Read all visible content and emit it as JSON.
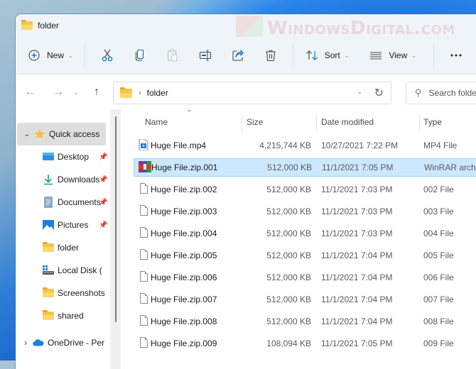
{
  "window": {
    "title": "folder",
    "watermark": "WindowsDigital.com"
  },
  "toolbar": {
    "new_label": "New",
    "sort_label": "Sort",
    "view_label": "View",
    "icons": [
      "cut-icon",
      "copy-icon",
      "paste-icon",
      "rename-icon",
      "share-icon",
      "delete-icon",
      "more-icon"
    ]
  },
  "navigation": {
    "address_path": [
      "folder"
    ],
    "search_placeholder": "Search folder"
  },
  "sidebar": {
    "items": [
      {
        "label": "Quick access",
        "icon": "star-icon",
        "expanded": true,
        "selected": true
      },
      {
        "label": "Desktop",
        "icon": "desktop-icon",
        "pinned": true
      },
      {
        "label": "Downloads",
        "icon": "download-icon",
        "pinned": true
      },
      {
        "label": "Documents",
        "icon": "document-icon",
        "pinned": true
      },
      {
        "label": "Pictures",
        "icon": "pictures-icon",
        "pinned": true
      },
      {
        "label": "folder",
        "icon": "folder-icon",
        "pinned": false
      },
      {
        "label": "Local Disk (C:)",
        "icon": "drive-icon",
        "pinned": false
      },
      {
        "label": "Screenshots",
        "icon": "folder-icon",
        "pinned": false
      },
      {
        "label": "shared",
        "icon": "folder-icon",
        "pinned": false
      },
      {
        "label": "OneDrive - Personal",
        "icon": "onedrive-icon",
        "expanded": false
      }
    ]
  },
  "filelist": {
    "columns": {
      "name": "Name",
      "size": "Size",
      "date": "Date modified",
      "type": "Type"
    },
    "sorted_by": "Name",
    "files": [
      {
        "name": "Huge File.mp4",
        "size": "4,215,744 KB",
        "date": "10/27/2021 7:22 PM",
        "type": "MP4 File",
        "icon": "video-file-icon",
        "selected": false
      },
      {
        "name": "Huge File.zip.001",
        "size": "512,000 KB",
        "date": "11/1/2021 7:05 PM",
        "type": "WinRAR archive",
        "icon": "winrar-icon",
        "selected": true
      },
      {
        "name": "Huge File.zip.002",
        "size": "512,000 KB",
        "date": "11/1/2021 7:03 PM",
        "type": "002 File",
        "icon": "blank-file-icon",
        "selected": false
      },
      {
        "name": "Huge File.zip.003",
        "size": "512,000 KB",
        "date": "11/1/2021 7:03 PM",
        "type": "003 File",
        "icon": "blank-file-icon",
        "selected": false
      },
      {
        "name": "Huge File.zip.004",
        "size": "512,000 KB",
        "date": "11/1/2021 7:03 PM",
        "type": "004 File",
        "icon": "blank-file-icon",
        "selected": false
      },
      {
        "name": "Huge File.zip.005",
        "size": "512,000 KB",
        "date": "11/1/2021 7:04 PM",
        "type": "005 File",
        "icon": "blank-file-icon",
        "selected": false
      },
      {
        "name": "Huge File.zip.006",
        "size": "512,000 KB",
        "date": "11/1/2021 7:04 PM",
        "type": "006 File",
        "icon": "blank-file-icon",
        "selected": false
      },
      {
        "name": "Huge File.zip.007",
        "size": "512,000 KB",
        "date": "11/1/2021 7:04 PM",
        "type": "007 File",
        "icon": "blank-file-icon",
        "selected": false
      },
      {
        "name": "Huge File.zip.008",
        "size": "512,000 KB",
        "date": "11/1/2021 7:04 PM",
        "type": "008 File",
        "icon": "blank-file-icon",
        "selected": false
      },
      {
        "name": "Huge File.zip.009",
        "size": "108,094 KB",
        "date": "11/1/2021 7:05 PM",
        "type": "009 File",
        "icon": "blank-file-icon",
        "selected": false
      }
    ]
  },
  "colors": {
    "accent": "#0067c0",
    "selection_bg": "#cce8ff",
    "selection_border": "#99d1ff",
    "toolbar_bg": "#eff4f9",
    "folder_yellow": "#f8c444"
  }
}
